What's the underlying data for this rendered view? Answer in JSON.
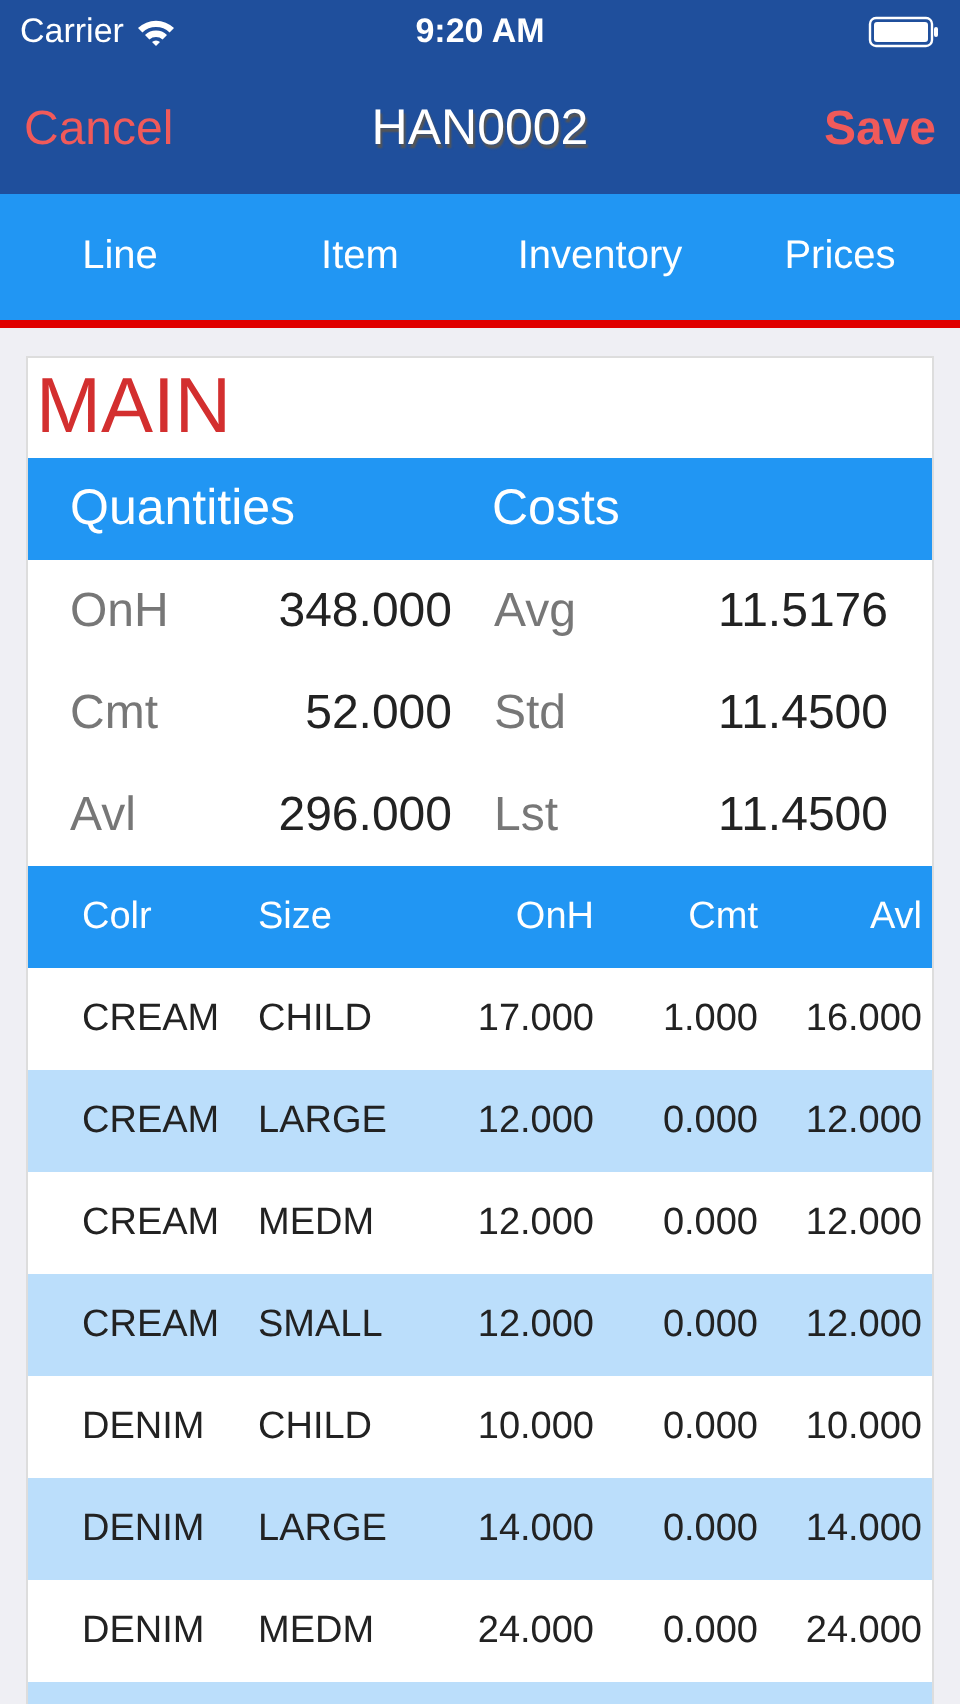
{
  "status_bar": {
    "carrier": "Carrier",
    "time": "9:20 AM"
  },
  "nav": {
    "cancel": "Cancel",
    "title": "HAN0002",
    "save": "Save"
  },
  "tabs": [
    "Line",
    "Item",
    "Inventory",
    "Prices"
  ],
  "section": "MAIN",
  "summary": {
    "headers": [
      "Quantities",
      "Costs"
    ],
    "rows": [
      {
        "q_label": "OnH",
        "q_value": "348.000",
        "c_label": "Avg",
        "c_value": "11.5176"
      },
      {
        "q_label": "Cmt",
        "q_value": "52.000",
        "c_label": "Std",
        "c_value": "11.4500"
      },
      {
        "q_label": "Avl",
        "q_value": "296.000",
        "c_label": "Lst",
        "c_value": "11.4500"
      }
    ]
  },
  "table": {
    "columns": [
      "Colr",
      "Size",
      "OnH",
      "Cmt",
      "Avl"
    ],
    "rows": [
      [
        "CREAM",
        "CHILD",
        "17.000",
        "1.000",
        "16.000"
      ],
      [
        "CREAM",
        "LARGE",
        "12.000",
        "0.000",
        "12.000"
      ],
      [
        "CREAM",
        "MEDM",
        "12.000",
        "0.000",
        "12.000"
      ],
      [
        "CREAM",
        "SMALL",
        "12.000",
        "0.000",
        "12.000"
      ],
      [
        "DENIM",
        "CHILD",
        "10.000",
        "0.000",
        "10.000"
      ],
      [
        "DENIM",
        "LARGE",
        "14.000",
        "0.000",
        "14.000"
      ],
      [
        "DENIM",
        "MEDM",
        "24.000",
        "0.000",
        "24.000"
      ]
    ]
  }
}
